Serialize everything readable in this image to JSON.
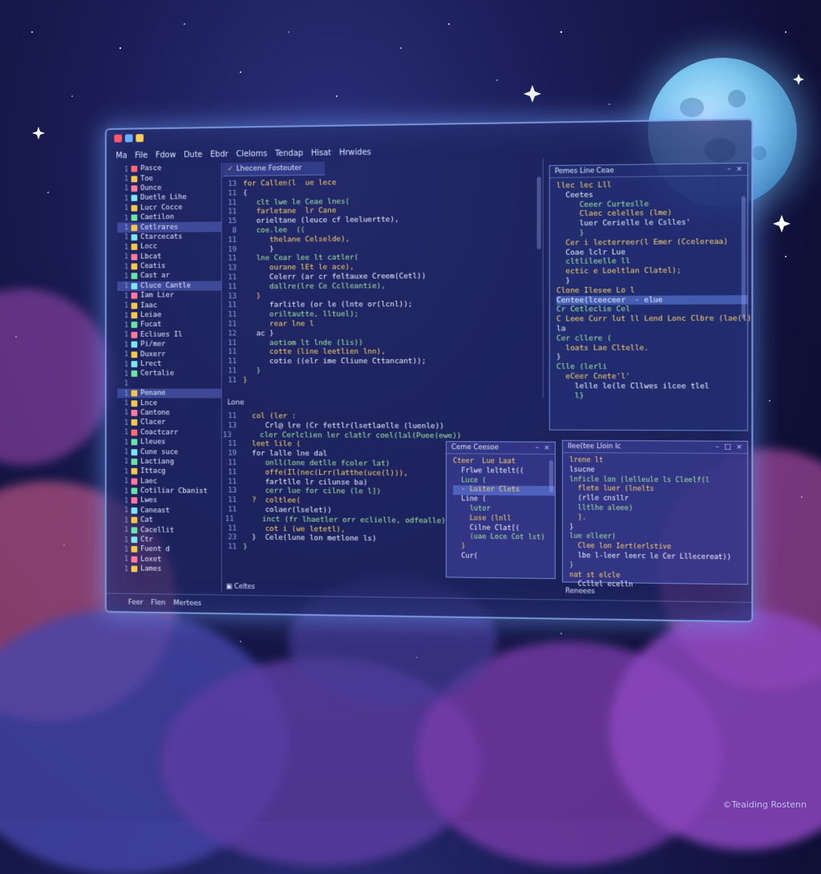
{
  "menu": [
    "Ma",
    "File",
    "Fdow",
    "Dute",
    "Ebdr",
    "Cleloms",
    "Tendap",
    "Hisat",
    "Hrwides"
  ],
  "sidebar": {
    "items": [
      {
        "label": "Pasce",
        "color": "#ff6b6b",
        "selected": false
      },
      {
        "label": "Toe",
        "color": "#f4c74a",
        "selected": false
      },
      {
        "label": "Ounce",
        "color": "#ff7a9c",
        "selected": false
      },
      {
        "label": "Duetle Lihe",
        "color": "#7ee5f2",
        "selected": false
      },
      {
        "label": "Lucr Cocce",
        "color": "#f4c74a",
        "selected": false
      },
      {
        "label": "Caetilon",
        "color": "#6be3a2",
        "selected": false
      },
      {
        "label": "Cetlrares",
        "color": "#f4c74a",
        "selected": true
      },
      {
        "label": "Ctarcecats",
        "color": "#7ee5f2",
        "selected": false
      },
      {
        "label": "Locc",
        "color": "#f4c74a",
        "selected": false
      },
      {
        "label": "Lbcat",
        "color": "#ff7a9c",
        "selected": false
      },
      {
        "label": "Ceatis",
        "color": "#f4c74a",
        "selected": false
      },
      {
        "label": "Cast ar",
        "color": "#6be3a2",
        "selected": false
      },
      {
        "label": "Cluce Cantle",
        "color": "#7ee5f2",
        "selected": true
      },
      {
        "label": "Iam Lier",
        "color": "#ff7a9c",
        "selected": false
      },
      {
        "label": "Iaac",
        "color": "#f4c74a",
        "selected": false
      },
      {
        "label": "Leiae",
        "color": "#f4c74a",
        "selected": false
      },
      {
        "label": "Fucat",
        "color": "#6be3a2",
        "selected": false
      },
      {
        "label": "Ecliues Il",
        "color": "#ff7a9c",
        "selected": false
      },
      {
        "label": "Pi/mer",
        "color": "#7ee5f2",
        "selected": false
      },
      {
        "label": "Duxerr",
        "color": "#f4c74a",
        "selected": false
      },
      {
        "label": "Lrect",
        "color": "#7ee5f2",
        "selected": false
      },
      {
        "label": "Certalie",
        "color": "#6be3a2",
        "selected": false
      },
      {
        "label": "",
        "color": "",
        "selected": false
      },
      {
        "label": "Penane",
        "color": "#f4c74a",
        "selected": true
      },
      {
        "label": "Lnce",
        "color": "#f4c74a",
        "selected": false
      },
      {
        "label": "Cantone",
        "color": "#ff7a9c",
        "selected": false
      },
      {
        "label": "Clacer",
        "color": "#f4c74a",
        "selected": false
      },
      {
        "label": "Coactcarr",
        "color": "#ff6b6b",
        "selected": false
      },
      {
        "label": "Lleues",
        "color": "#6be3a2",
        "selected": false
      },
      {
        "label": "Cune suce",
        "color": "#7ee5f2",
        "selected": false
      },
      {
        "label": "Lactiang",
        "color": "#6be3a2",
        "selected": false
      },
      {
        "label": "Ittacg",
        "color": "#f4c74a",
        "selected": false
      },
      {
        "label": "Laec",
        "color": "#ff7a9c",
        "selected": false
      },
      {
        "label": "Cotiliar Cbanist",
        "color": "#6be3a2",
        "selected": false
      },
      {
        "label": "Lwes",
        "color": "#ff7a9c",
        "selected": false
      },
      {
        "label": "Caneast",
        "color": "#7ee5f2",
        "selected": false
      },
      {
        "label": "Cat",
        "color": "#f4c74a",
        "selected": false
      },
      {
        "label": "Cacellit",
        "color": "#6be3a2",
        "selected": false
      },
      {
        "label": "Ctr",
        "color": "#7ee5f2",
        "selected": false
      },
      {
        "label": "Fuent d",
        "color": "#f4c74a",
        "selected": false
      },
      {
        "label": "Loxet",
        "color": "#ff7a9c",
        "selected": false
      },
      {
        "label": "Lames",
        "color": "#f4c74a",
        "selected": false
      }
    ]
  },
  "editor": {
    "tab": "Lhecene Fosteuter",
    "lines": [
      {
        "ln": "13",
        "text": "for Callen(l  ue lece"
      },
      {
        "ln": "11",
        "text": "{"
      },
      {
        "ln": "11",
        "text": "   clt lwe le Ceae lnes("
      },
      {
        "ln": "11",
        "text": "   farletane  lr Cane"
      },
      {
        "ln": "15",
        "text": "   orieltane (leuce cf leeluertte),"
      },
      {
        "ln": "8",
        "text": "   coe.lee  (("
      },
      {
        "ln": "11",
        "text": "      thelane Celselde),"
      },
      {
        "ln": "19",
        "text": "      }"
      },
      {
        "ln": "11",
        "text": "   lne Cear lee lt catler("
      },
      {
        "ln": "13",
        "text": "      ourane lEt le ace),"
      },
      {
        "ln": "11",
        "text": "      Celerr (ar cr feltauxe Creem(Cetl))"
      },
      {
        "ln": "11",
        "text": "      dallre(lre Ce Cclleantie),"
      },
      {
        "ln": "13",
        "text": "   }"
      },
      {
        "ln": "11",
        "text": "      farlitle (or le (lnte or(lcnl));"
      },
      {
        "ln": "11",
        "text": "      oriltautte, lltuel);"
      },
      {
        "ln": "11",
        "text": "      rear lne l"
      },
      {
        "ln": "12",
        "text": "   ac }"
      },
      {
        "ln": "11",
        "text": "      aotiom lt lnde (lis))"
      },
      {
        "ln": "11",
        "text": "      cotte (line leetlien lnn),"
      },
      {
        "ln": "11",
        "text": "      cotie ((elr ime Cliune Cttancant));"
      },
      {
        "ln": "11",
        "text": "   }"
      },
      {
        "ln": "11",
        "text": "}"
      }
    ]
  },
  "editor2": {
    "header": "Lone",
    "lines": [
      {
        "ln": "11",
        "text": "  col (ler :"
      },
      {
        "ln": "13",
        "text": "     Crl@ lre (Cr fettlr(lsetlaelle (luenle))"
      },
      {
        "ln": "13",
        "text": "     cler Cerlclien ler clatlr coel(lal(Puee(ewe))"
      },
      {
        "ln": "11",
        "text": "  leet lile ("
      },
      {
        "ln": "19",
        "text": "  for lalle lne dal"
      },
      {
        "ln": "11",
        "text": "     onll(lone detlle fcoler lat)"
      },
      {
        "ln": "11",
        "text": "     offe(Il(nec(Lrr(latthe(uce(l))),"
      },
      {
        "ln": "11",
        "text": "     farltlle lr cilunse ba)"
      },
      {
        "ln": "13",
        "text": "     cerr lue for cilne (le l])"
      },
      {
        "ln": "11",
        "text": "  ?  coltlee("
      },
      {
        "ln": "11",
        "text": "     colaer(lselet))"
      },
      {
        "ln": "11",
        "text": "     inct (fr lhaetler orr eclielle, odfealle)"
      },
      {
        "ln": "11",
        "text": "     cot i (we letetl),"
      },
      {
        "ln": "23",
        "text": "  }  Cele(lune lon metlone ls)"
      },
      {
        "ln": "11",
        "text": "}"
      }
    ]
  },
  "right_panel": {
    "title": "Pemes  Line Ceae",
    "lines": [
      {
        "text": "llec lec Lll",
        "hl": false
      },
      {
        "text": "  Ceetes",
        "hl": false
      },
      {
        "text": "     Ceeer Curteslle",
        "hl": false
      },
      {
        "text": "     Claec celelles (lme)",
        "hl": false
      },
      {
        "text": "     luer Cerielle le Cslles'",
        "hl": false
      },
      {
        "text": "     }",
        "hl": false
      },
      {
        "text": "  Cer i lecterreer(l Emer (Ccelereaa)",
        "hl": false
      },
      {
        "text": "  Coae lclr Lue",
        "hl": false
      },
      {
        "text": "  cltlileelle ll",
        "hl": false
      },
      {
        "text": "  ectic e Loeltlan Clatel);",
        "hl": false
      },
      {
        "text": "  }",
        "hl": false
      },
      {
        "text": "",
        "hl": false
      },
      {
        "text": "Clone Ilesee Lo l",
        "hl": false
      },
      {
        "text": "Centee(lceeceer  - elue",
        "hl": true
      },
      {
        "text": "Cr Cetleclie Cel",
        "hl": false
      },
      {
        "text": "C Leee Curr lut ll Lend Lonc Clbre (lae(l);",
        "hl": false
      },
      {
        "text": "la",
        "hl": false
      },
      {
        "text": "Cer cllere (",
        "hl": false
      },
      {
        "text": "  loats Lae Cltelle.",
        "hl": false
      },
      {
        "text": "}",
        "hl": false
      },
      {
        "text": "Clle (lerli",
        "hl": false
      },
      {
        "text": "  eCeer Cnete'l'",
        "hl": false
      },
      {
        "text": "    lelle le(le Cllwes ilcee tlel",
        "hl": false
      },
      {
        "text": "    l}",
        "hl": false
      }
    ]
  },
  "panel_a": {
    "title": "Ceme  Ceesoe",
    "lines": [
      {
        "text": "Cteer  Lue Laat",
        "hl": false
      },
      {
        "text": "  Frlwe leltelt((",
        "hl": false
      },
      {
        "text": "  Luce (",
        "hl": false
      },
      {
        "text": "  - Luiter Clets",
        "hl": true
      },
      {
        "text": "  Line (",
        "hl": false
      },
      {
        "text": "    lutor",
        "hl": false
      },
      {
        "text": "    Luse (lnll",
        "hl": false
      },
      {
        "text": "    Cilne Clat[(",
        "hl": false
      },
      {
        "text": "    (uae Loce Cot lst)",
        "hl": false
      },
      {
        "text": "  }",
        "hl": false
      },
      {
        "text": "  Cur(",
        "hl": false
      }
    ]
  },
  "panel_b": {
    "title": "Ilee(tee Lloin lc",
    "lines": [
      {
        "text": "lrene lt",
        "hl": false
      },
      {
        "text": "lsucne",
        "hl": false
      },
      {
        "text": "lnficle lon (lelleule ls Cleelf(l",
        "hl": false
      },
      {
        "text": "  flete luer (lnelts",
        "hl": false
      },
      {
        "text": "  (rlle cnsllr",
        "hl": false
      },
      {
        "text": "  lltlhe aleee)",
        "hl": false
      },
      {
        "text": "  ].",
        "hl": false
      },
      {
        "text": "}",
        "hl": false
      },
      {
        "text": "lue elleer)",
        "hl": false
      },
      {
        "text": "  Clee lon Iert(erlstive",
        "hl": false
      },
      {
        "text": "  lbe l-leer leerc le Cer Lllecereat))",
        "hl": false
      },
      {
        "text": "}",
        "hl": false
      },
      {
        "text": "nat st elcle",
        "hl": false
      },
      {
        "text": "  Ccllel ecelln",
        "hl": false
      }
    ]
  },
  "statusbar": {
    "items": [
      "Feer",
      "Flen",
      "Mertees"
    ],
    "editor_tab": "Celtes",
    "right": "Reneees"
  },
  "watermark": "©Teaiding Rostenn"
}
